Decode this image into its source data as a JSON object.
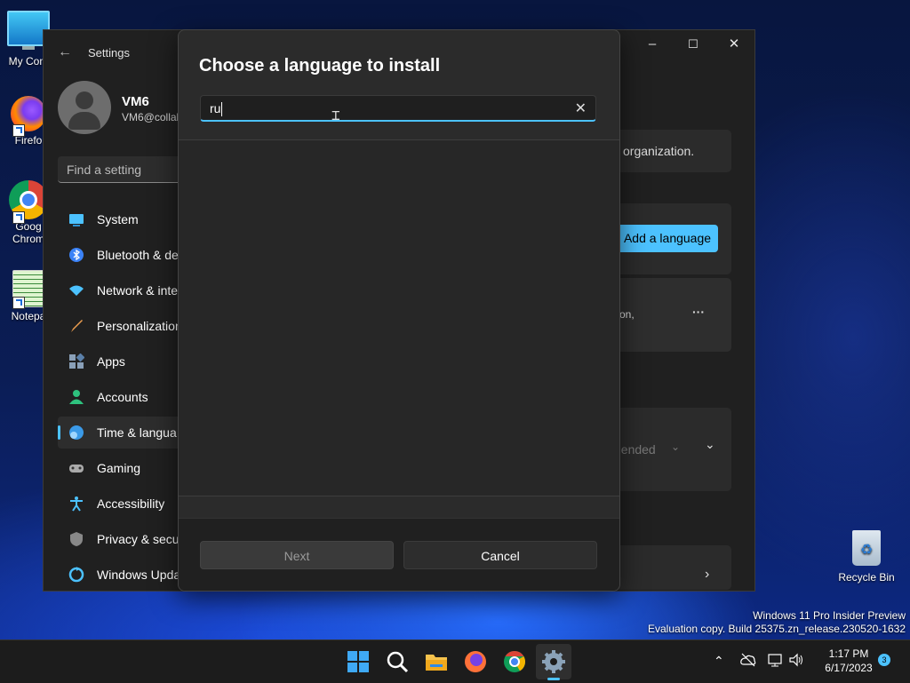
{
  "desktop": {
    "icons": [
      {
        "label": "My Com",
        "icon": "computer-icon"
      },
      {
        "label": "Firefo",
        "icon": "firefox-icon"
      },
      {
        "label": "Goog\nChrom",
        "icon": "chrome-icon"
      },
      {
        "label": "Notepa",
        "icon": "notepad-icon"
      }
    ],
    "recycle_bin": "Recycle Bin",
    "watermark": {
      "line1": "Windows 11 Pro Insider Preview",
      "line2": "Evaluation copy. Build 25375.zn_release.230520-1632"
    }
  },
  "settings_window": {
    "title": "Settings",
    "controls": {
      "minimize": "–",
      "maximize": "☐",
      "close": "✕"
    },
    "user": {
      "name": "VM6",
      "email": "VM6@collab"
    },
    "search_placeholder": "Find a setting",
    "nav": [
      {
        "label": "System",
        "icon": "system-icon",
        "color": "#4cc2ff"
      },
      {
        "label": "Bluetooth & de",
        "icon": "bluetooth-icon",
        "color": "#4c9dff"
      },
      {
        "label": "Network & inte",
        "icon": "wifi-icon",
        "color": "#4cc2ff"
      },
      {
        "label": "Personalization",
        "icon": "brush-icon",
        "color": "#f0a050"
      },
      {
        "label": "Apps",
        "icon": "apps-icon",
        "color": "#9ab"
      },
      {
        "label": "Accounts",
        "icon": "accounts-icon",
        "color": "#2ec27e"
      },
      {
        "label": "Time & langua",
        "icon": "time-language-icon",
        "color": "#4cc2ff",
        "active": true
      },
      {
        "label": "Gaming",
        "icon": "gaming-icon",
        "color": "#bbb"
      },
      {
        "label": "Accessibility",
        "icon": "accessibility-icon",
        "color": "#4cc2ff"
      },
      {
        "label": "Privacy & secu",
        "icon": "shield-icon",
        "color": "#888"
      },
      {
        "label": "Windows Upda",
        "icon": "update-icon",
        "color": "#4cc2ff"
      }
    ],
    "right_content": {
      "org_text": "organization.",
      "add_language_label": "Add a language",
      "card_text": "on,",
      "more_label": "···",
      "dropdown_text": "nended",
      "chevron_label": "⌄"
    }
  },
  "dialog": {
    "title": "Choose a language to install",
    "search_value": "ru",
    "clear_label": "✕",
    "next_label": "Next",
    "cancel_label": "Cancel"
  },
  "taskbar": {
    "items": [
      "start-icon",
      "search-icon",
      "file-explorer-icon",
      "firefox-icon",
      "chrome-icon",
      "settings-icon"
    ],
    "time": "1:17 PM",
    "date": "6/17/2023",
    "notification_count": "3",
    "tray": {
      "chevron": "⌃",
      "network": "🖧",
      "volume": "🔊"
    }
  },
  "colors": {
    "accent": "#4cc2ff",
    "dialog_bg": "#2b2b2b",
    "window_bg": "#202020"
  }
}
